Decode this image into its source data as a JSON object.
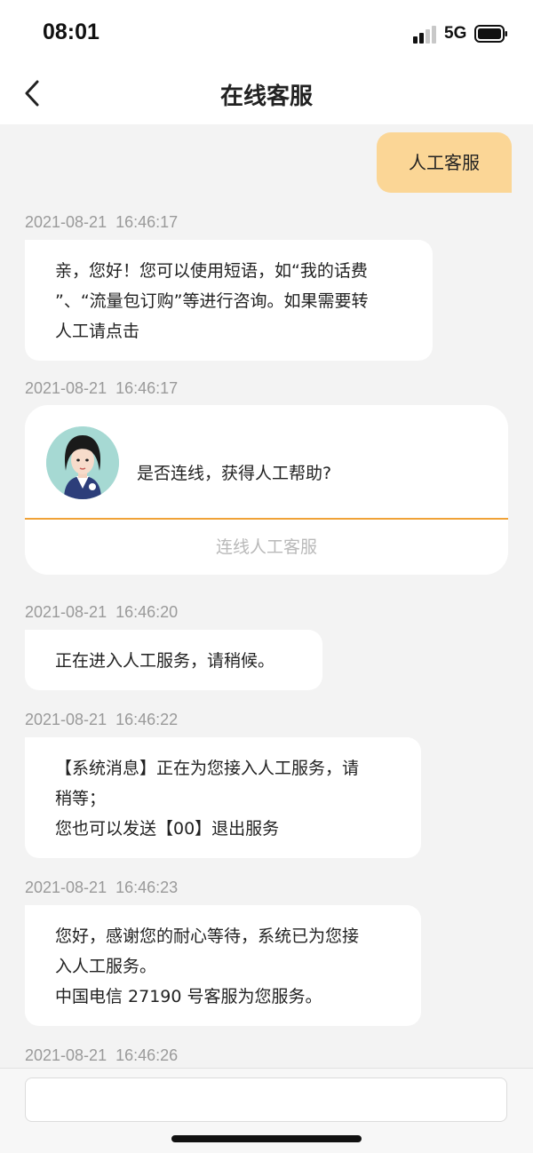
{
  "status_bar": {
    "time": "08:01",
    "network": "5G",
    "icons": [
      "signal-icon",
      "battery-icon"
    ]
  },
  "nav": {
    "title": "在线客服",
    "back_icon": "chevron-left-icon"
  },
  "user_message": {
    "text": "人工客服"
  },
  "messages": [
    {
      "timestamp": "2021-08-21  16:46:17",
      "lines": [
        "亲，您好！您可以使用短语，如“我的话费",
        "”、“流量包订购”等进行咨询。如果需要转",
        "人工请点击"
      ]
    },
    {
      "timestamp": "2021-08-21  16:46:20",
      "lines": [
        "正在进入人工服务，请稍候。"
      ]
    },
    {
      "timestamp": "2021-08-21  16:46:22",
      "lines": [
        "【系统消息】正在为您接入人工服务，请",
        "稍等；",
        "您也可以发送【00】退出服务"
      ]
    },
    {
      "timestamp": "2021-08-21  16:46:23",
      "lines": [
        "您好，感谢您的耐心等待，系统已为您接",
        "入人工服务。",
        "中国电信 27190 号客服为您服务。"
      ]
    },
    {
      "timestamp": "2021-08-21  16:46:26",
      "lines": []
    }
  ],
  "connect_card": {
    "timestamp": "2021-08-21  16:46:17",
    "question": "是否连线，获得人工帮助?",
    "button_label": "连线人工客服",
    "avatar_icon": "agent-avatar-icon",
    "accent_color": "#f0a237"
  },
  "input": {
    "value": "",
    "placeholder": ""
  },
  "colors": {
    "user_bubble": "#fbd696",
    "background": "#f3f3f3",
    "timestamp": "#9a9a9a"
  }
}
